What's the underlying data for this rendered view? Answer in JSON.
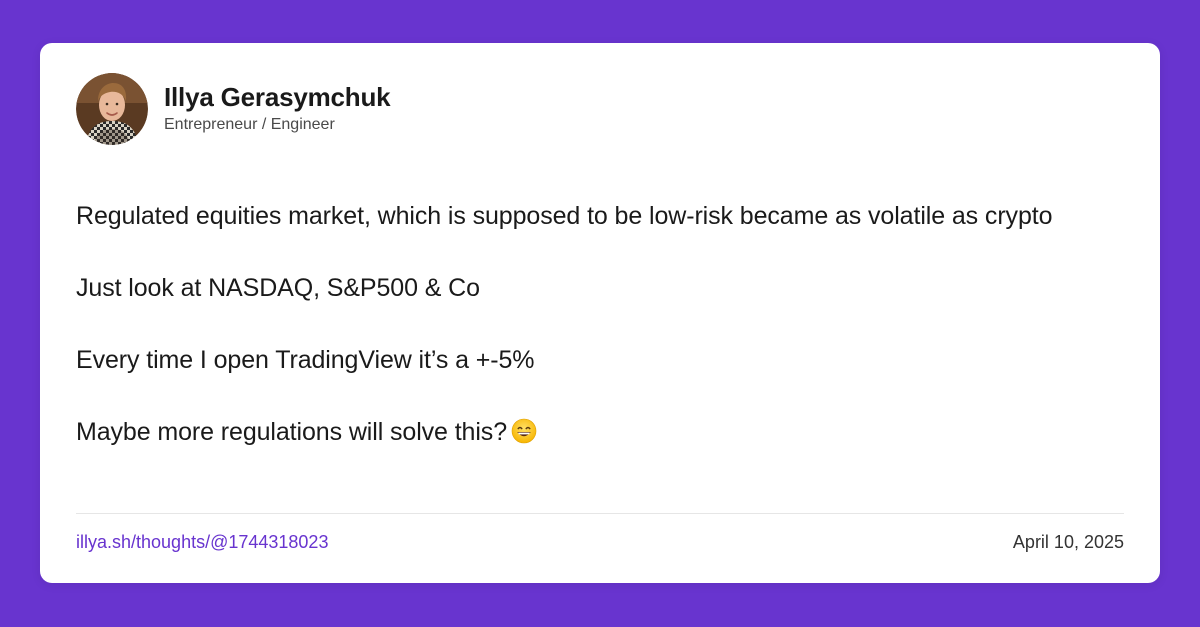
{
  "author": {
    "name": "Illya Gerasymchuk",
    "role": "Entrepreneur / Engineer"
  },
  "post": {
    "paragraphs": [
      "Regulated equities market, which is supposed to be low-risk became as volatile as crypto",
      "Just look at NASDAQ, S&P500 & Co",
      "Every time I open TradingView it’s a +-5%",
      "Maybe more regulations will solve this?"
    ],
    "emoji": "grinning-face-icon"
  },
  "footer": {
    "link": "illya.sh/thoughts/@1744318023",
    "date": "April 10, 2025"
  },
  "colors": {
    "background": "#6834cf",
    "card": "#ffffff",
    "link": "#6834cf",
    "text": "#1a1a1a"
  }
}
